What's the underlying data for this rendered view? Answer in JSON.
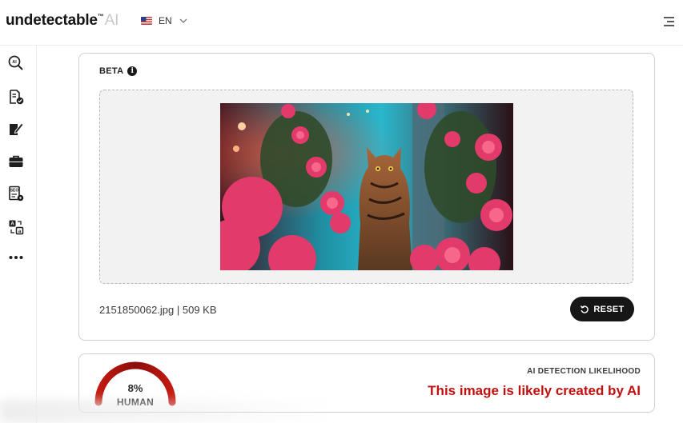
{
  "header": {
    "logo_text": "undetectable",
    "logo_tm": "™",
    "logo_ai": "AI",
    "language": "EN"
  },
  "sidebar": {
    "items": [
      {
        "icon": "ai-detector-icon"
      },
      {
        "icon": "document-check-icon"
      },
      {
        "icon": "edit-document-icon"
      },
      {
        "icon": "briefcase-icon"
      },
      {
        "icon": "seo-document-icon"
      },
      {
        "icon": "translate-icon"
      },
      {
        "icon": "more-icon"
      }
    ]
  },
  "upload": {
    "beta_label": "BETA",
    "info_glyph": "i",
    "file_meta": "2151850062.jpg | 509 KB",
    "reset_label": "RESET"
  },
  "result": {
    "percent": "8%",
    "gauge_value": 0.08,
    "gauge_label": "HUMAN",
    "likelihood_label": "AI DETECTION LIKELIHOOD",
    "verdict": "This image is likely created by AI",
    "verdict_color": "#c0110f"
  }
}
